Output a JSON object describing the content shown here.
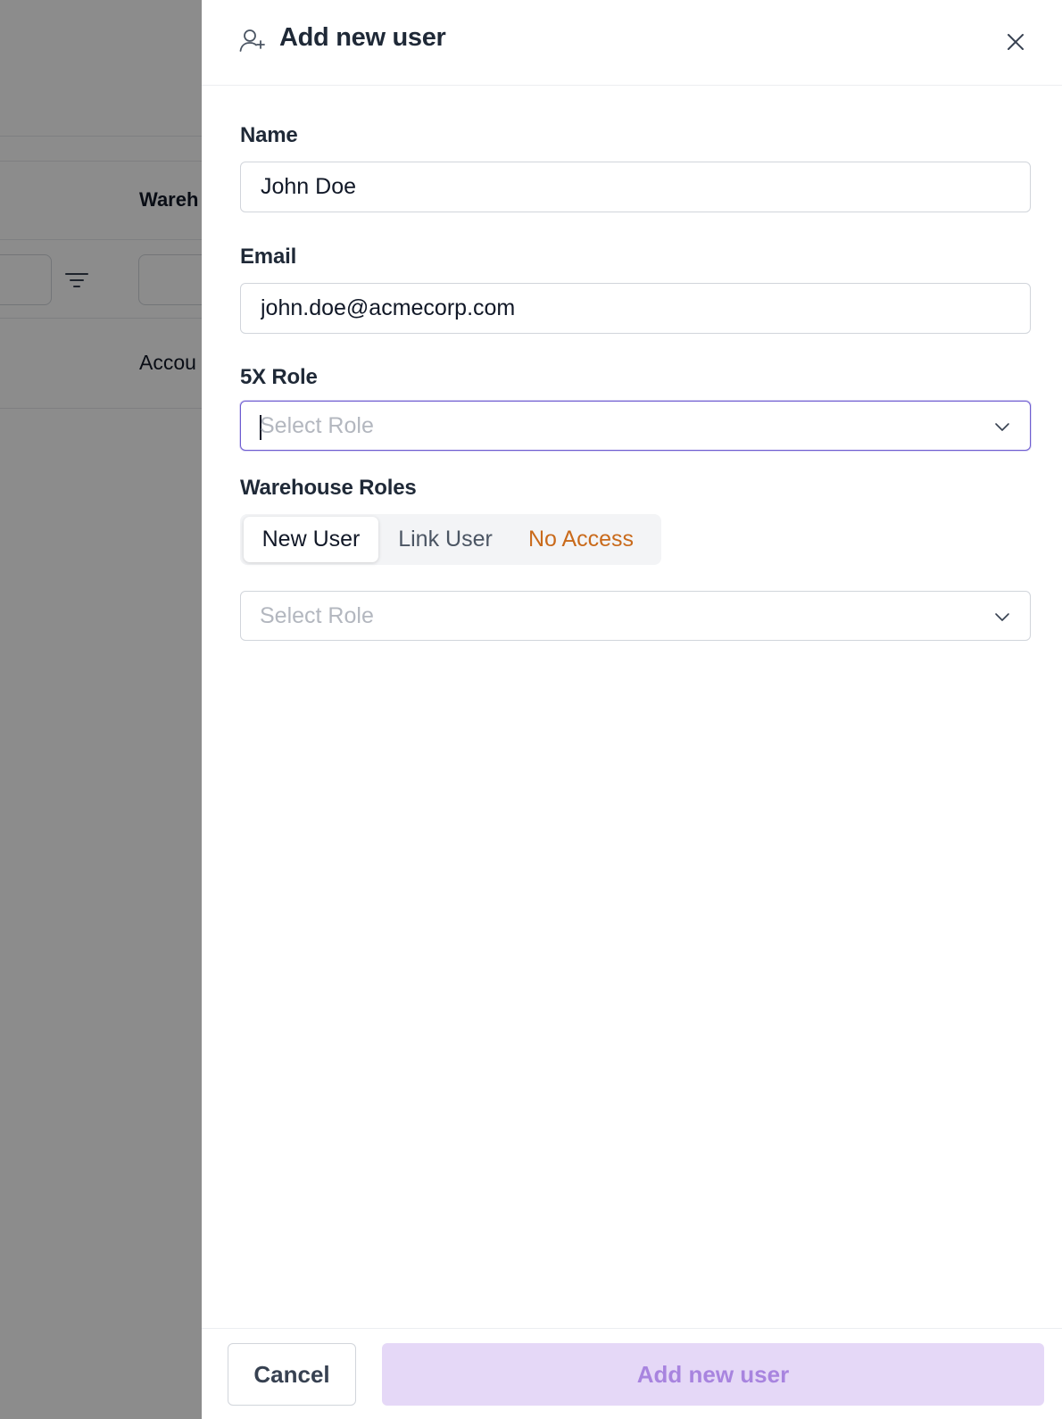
{
  "background": {
    "column_header": "Wareh",
    "cell_text": "Accou"
  },
  "drawer": {
    "title": "Add new user",
    "title_icon": "user-plus-icon",
    "close_icon": "close-icon"
  },
  "form": {
    "name": {
      "label": "Name",
      "value": "John Doe"
    },
    "email": {
      "label": "Email",
      "value": "john.doe@acmecorp.com"
    },
    "role_5x": {
      "label": "5X Role",
      "placeholder": "Select Role",
      "focused": true
    },
    "warehouse_roles": {
      "label": "Warehouse Roles",
      "tabs": [
        {
          "label": "New User",
          "selected": true
        },
        {
          "label": "Link User",
          "selected": false
        },
        {
          "label": "No Access",
          "selected": false
        }
      ],
      "select_placeholder": "Select Role"
    }
  },
  "footer": {
    "cancel_label": "Cancel",
    "submit_label": "Add new user",
    "submit_enabled": false
  },
  "colors": {
    "accent": "#6d5bd0",
    "primary_disabled_bg": "#e5d8f7",
    "primary_disabled_text": "#a884df",
    "no_access_text": "#c96a1b",
    "overlay": "rgba(0,0,0,0.45)"
  }
}
